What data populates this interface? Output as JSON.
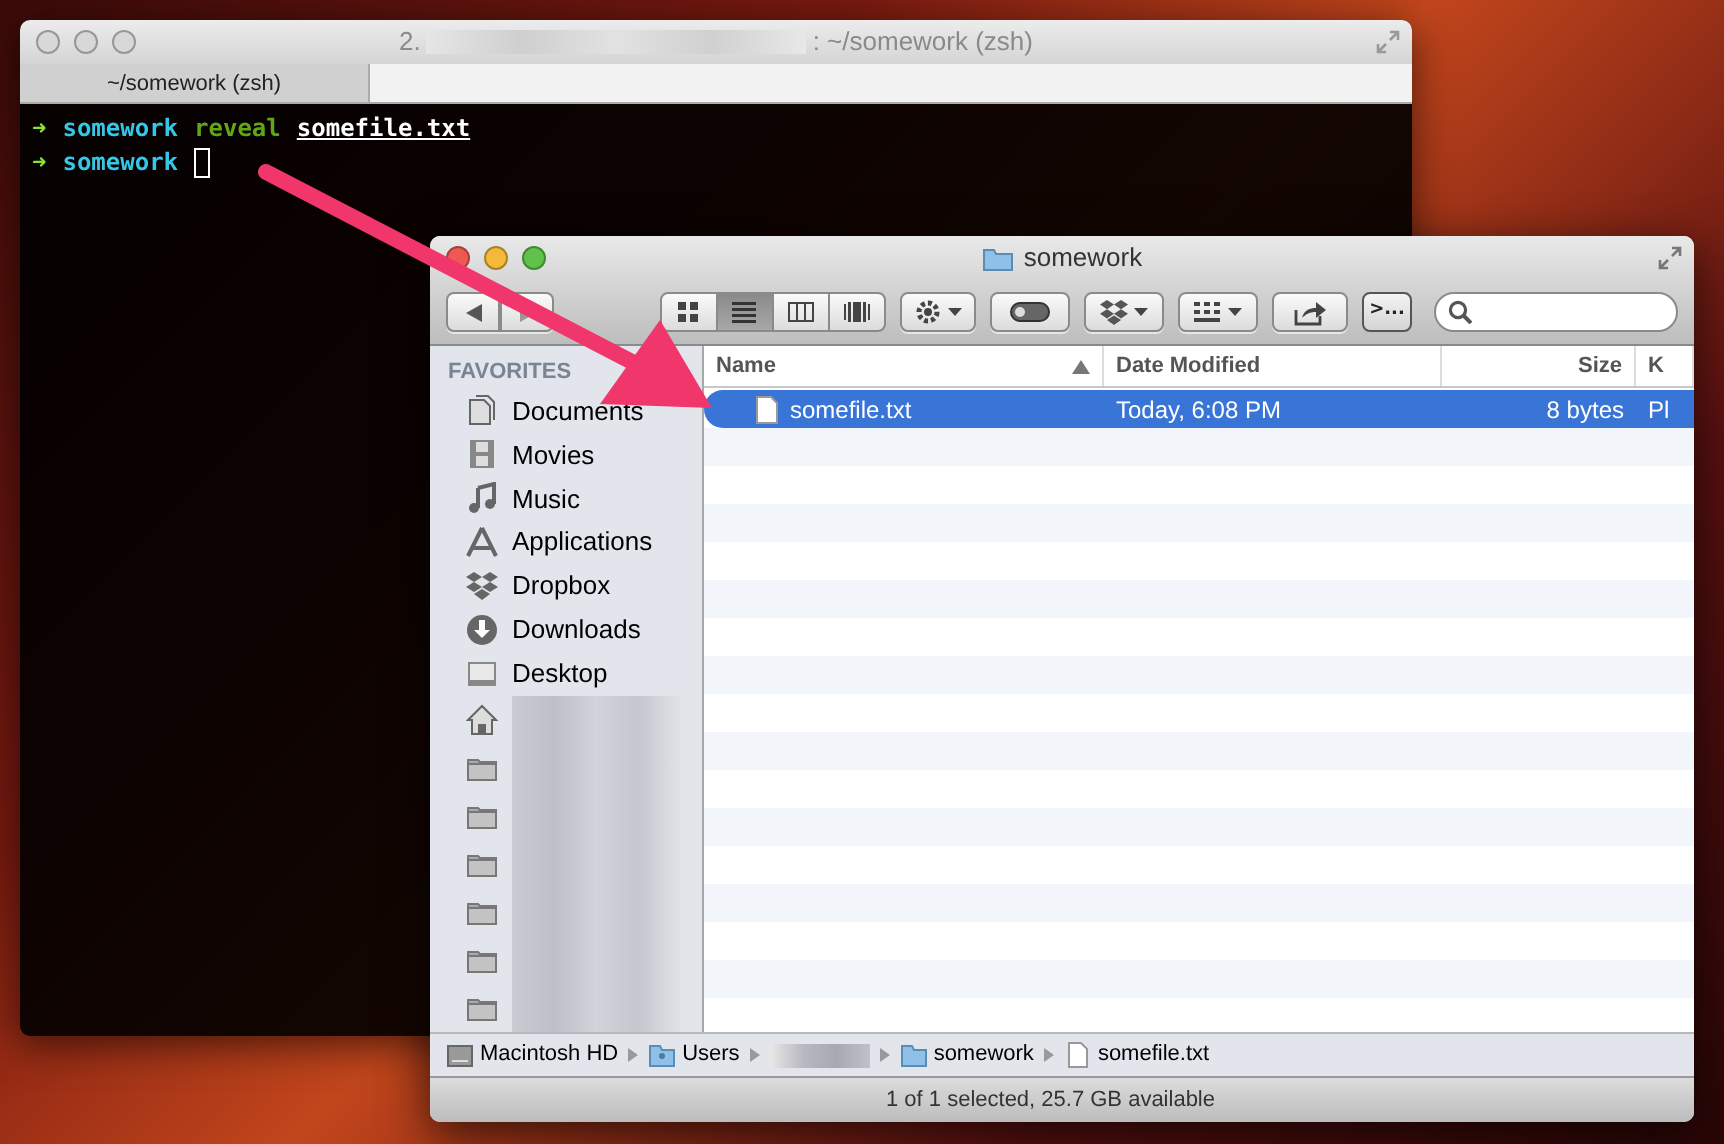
{
  "terminal": {
    "title_prefix": "2.",
    "title_suffix": ": ~/somework (zsh)",
    "tabs": [
      {
        "label": "~/somework (zsh)",
        "selected": true
      }
    ],
    "lines": [
      {
        "segments": [
          {
            "kind": "arrow",
            "text": "➜"
          },
          {
            "kind": "dir",
            "text": "somework"
          },
          {
            "kind": "command",
            "text": "reveal"
          },
          {
            "kind": "argument",
            "text": "somefile.txt"
          }
        ]
      },
      {
        "segments": [
          {
            "kind": "arrow",
            "text": "➜"
          },
          {
            "kind": "dir",
            "text": "somework"
          }
        ],
        "cursor": true
      }
    ]
  },
  "finder": {
    "title": "somework",
    "view_buttons": [
      {
        "kind": "icons",
        "selected": false
      },
      {
        "kind": "list",
        "selected": true
      },
      {
        "kind": "columns",
        "selected": false
      },
      {
        "kind": "coverflow",
        "selected": false
      }
    ],
    "terminal_button": ">...",
    "sidebar": {
      "heading": "FAVORITES",
      "items": [
        {
          "kind": "documents",
          "label": "Documents"
        },
        {
          "kind": "movies",
          "label": "Movies"
        },
        {
          "kind": "music",
          "label": "Music"
        },
        {
          "kind": "applications",
          "label": "Applications"
        },
        {
          "kind": "dropbox",
          "label": "Dropbox"
        },
        {
          "kind": "downloads",
          "label": "Downloads"
        },
        {
          "kind": "desktop",
          "label": "Desktop"
        },
        {
          "kind": "home"
        },
        {
          "kind": "folder"
        },
        {
          "kind": "folder"
        },
        {
          "kind": "folder"
        },
        {
          "kind": "folder"
        },
        {
          "kind": "folder"
        },
        {
          "kind": "folder"
        }
      ]
    },
    "table": {
      "columns": [
        {
          "label": "Name",
          "sorted": true
        },
        {
          "label": "Date Modified",
          "sorted": false
        },
        {
          "label": "Size",
          "sorted": false
        },
        {
          "label": "K",
          "sorted": false
        }
      ],
      "rows": [
        {
          "name": "somefile.txt",
          "date": "Today, 6:08 PM",
          "size": "8 bytes",
          "column_4": "Pl",
          "selected": true
        }
      ]
    },
    "path": [
      {
        "kind": "disk",
        "label": "Macintosh HD"
      },
      {
        "kind": "users",
        "label": "Users"
      },
      {
        "kind": "hidden"
      },
      {
        "kind": "folder",
        "label": "somework"
      },
      {
        "kind": "file",
        "label": "somefile.txt"
      }
    ],
    "status": "1 of 1 selected, 25.7 GB available"
  }
}
